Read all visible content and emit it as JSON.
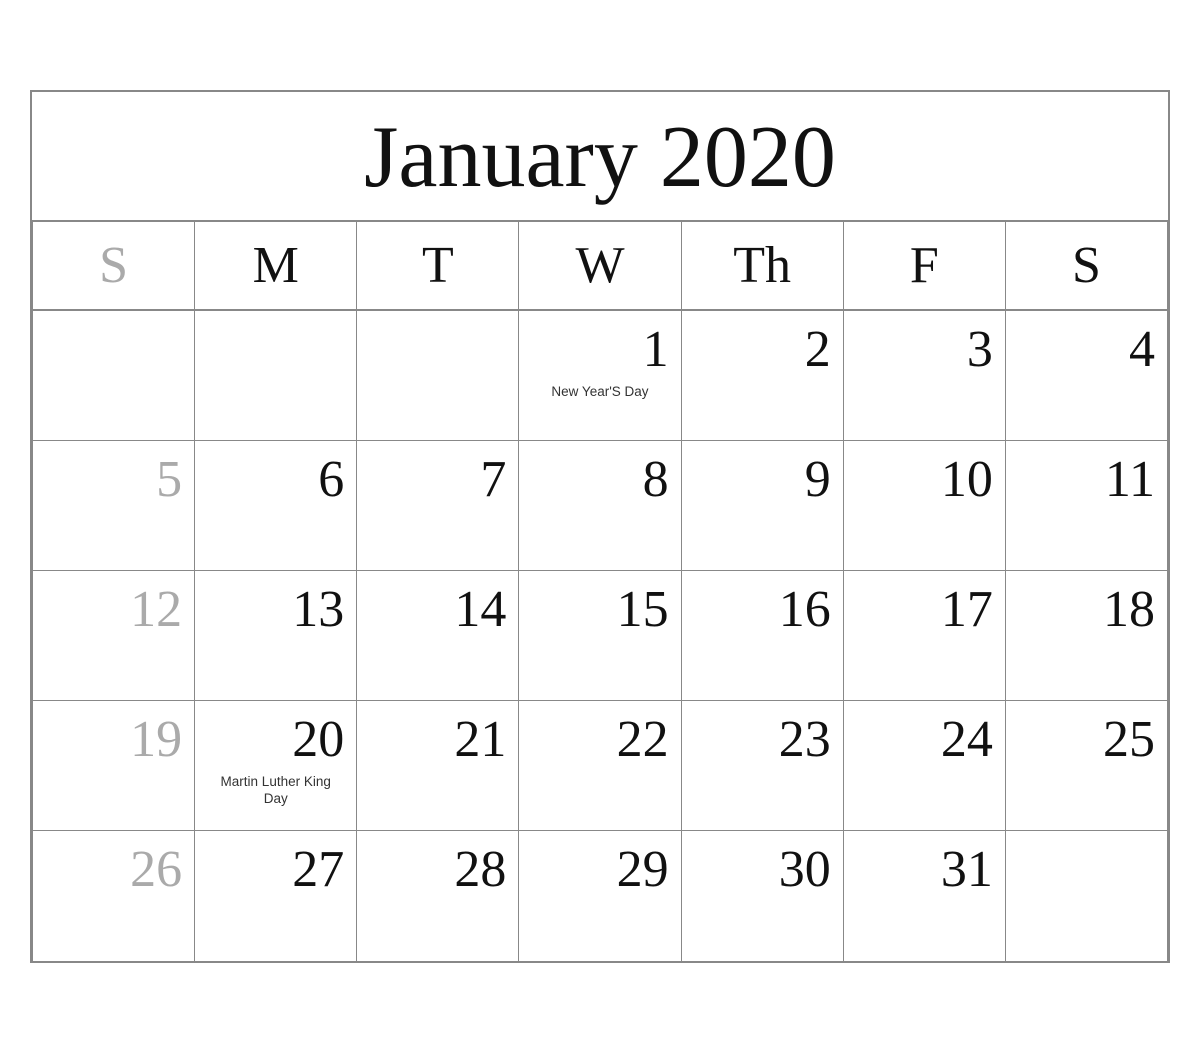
{
  "calendar": {
    "title": "January 2020",
    "headers": [
      {
        "label": "S",
        "type": "sunday"
      },
      {
        "label": "M",
        "type": "weekday"
      },
      {
        "label": "T",
        "type": "weekday"
      },
      {
        "label": "W",
        "type": "weekday"
      },
      {
        "label": "Th",
        "type": "weekday"
      },
      {
        "label": "F",
        "type": "weekday"
      },
      {
        "label": "S",
        "type": "weekday"
      }
    ],
    "weeks": [
      {
        "days": [
          {
            "num": "",
            "empty": true
          },
          {
            "num": "",
            "empty": true
          },
          {
            "num": "",
            "empty": true
          },
          {
            "num": "1",
            "holiday": "New Year'S Day",
            "type": "weekday"
          },
          {
            "num": "2",
            "type": "weekday"
          },
          {
            "num": "3",
            "type": "weekday"
          },
          {
            "num": "4",
            "type": "saturday"
          }
        ]
      },
      {
        "days": [
          {
            "num": "5",
            "type": "sunday"
          },
          {
            "num": "6",
            "type": "weekday"
          },
          {
            "num": "7",
            "type": "weekday"
          },
          {
            "num": "8",
            "type": "weekday"
          },
          {
            "num": "9",
            "type": "weekday"
          },
          {
            "num": "10",
            "type": "weekday"
          },
          {
            "num": "11",
            "type": "saturday"
          }
        ]
      },
      {
        "days": [
          {
            "num": "12",
            "type": "sunday"
          },
          {
            "num": "13",
            "type": "weekday"
          },
          {
            "num": "14",
            "type": "weekday"
          },
          {
            "num": "15",
            "type": "weekday"
          },
          {
            "num": "16",
            "type": "weekday"
          },
          {
            "num": "17",
            "type": "weekday"
          },
          {
            "num": "18",
            "type": "saturday"
          }
        ]
      },
      {
        "days": [
          {
            "num": "19",
            "type": "sunday"
          },
          {
            "num": "20",
            "holiday": "Martin Luther King Day",
            "type": "weekday"
          },
          {
            "num": "21",
            "type": "weekday"
          },
          {
            "num": "22",
            "type": "weekday"
          },
          {
            "num": "23",
            "type": "weekday"
          },
          {
            "num": "24",
            "type": "weekday"
          },
          {
            "num": "25",
            "type": "saturday"
          }
        ]
      },
      {
        "days": [
          {
            "num": "26",
            "type": "sunday"
          },
          {
            "num": "27",
            "type": "weekday"
          },
          {
            "num": "28",
            "type": "weekday"
          },
          {
            "num": "29",
            "type": "weekday"
          },
          {
            "num": "30",
            "type": "weekday"
          },
          {
            "num": "31",
            "type": "weekday"
          },
          {
            "num": "",
            "empty": true
          }
        ]
      }
    ]
  }
}
